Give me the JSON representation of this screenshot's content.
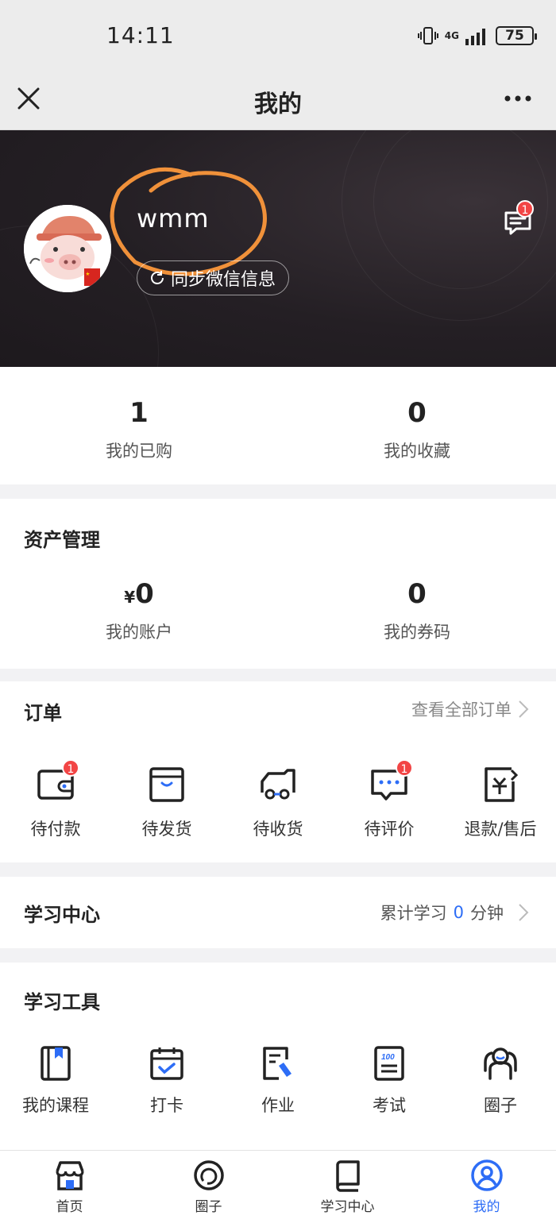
{
  "status_bar": {
    "time": "14:11",
    "network": "4G",
    "battery": "75"
  },
  "nav": {
    "title": "我的"
  },
  "profile": {
    "username": "wmm",
    "sync_label": "同步微信信息",
    "message_badge": "1"
  },
  "summary": [
    {
      "value": "1",
      "label": "我的已购"
    },
    {
      "value": "0",
      "label": "我的收藏"
    }
  ],
  "assets": {
    "title": "资产管理",
    "account": {
      "currency": "¥",
      "value": "0",
      "label": "我的账户"
    },
    "coupons": {
      "value": "0",
      "label": "我的券码"
    }
  },
  "orders": {
    "title": "订单",
    "view_all": "查看全部订单",
    "items": [
      {
        "label": "待付款",
        "icon": "wallet-icon",
        "badge": "1"
      },
      {
        "label": "待发货",
        "icon": "box-icon",
        "badge": ""
      },
      {
        "label": "待收货",
        "icon": "truck-icon",
        "badge": ""
      },
      {
        "label": "待评价",
        "icon": "comment-icon",
        "badge": "1"
      },
      {
        "label": "退款/售后",
        "icon": "refund-icon",
        "badge": ""
      }
    ]
  },
  "learning": {
    "title": "学习中心",
    "prefix": "累计学习",
    "minutes": "0",
    "suffix": "分钟"
  },
  "tools": {
    "title": "学习工具",
    "items": [
      {
        "label": "我的课程",
        "icon": "course-book-icon"
      },
      {
        "label": "打卡",
        "icon": "calendar-check-icon"
      },
      {
        "label": "作业",
        "icon": "homework-icon"
      },
      {
        "label": "考试",
        "icon": "exam-icon"
      },
      {
        "label": "圈子",
        "icon": "community-icon"
      }
    ]
  },
  "tabbar": [
    {
      "label": "首页",
      "icon": "home-store-icon"
    },
    {
      "label": "圈子",
      "icon": "circle-chat-icon"
    },
    {
      "label": "学习中心",
      "icon": "book-icon"
    },
    {
      "label": "我的",
      "icon": "user-icon"
    }
  ],
  "colors": {
    "accent": "#2d6df6",
    "badge": "#f24545",
    "header_bg": "#241f24",
    "annotation": "#f0913a"
  }
}
